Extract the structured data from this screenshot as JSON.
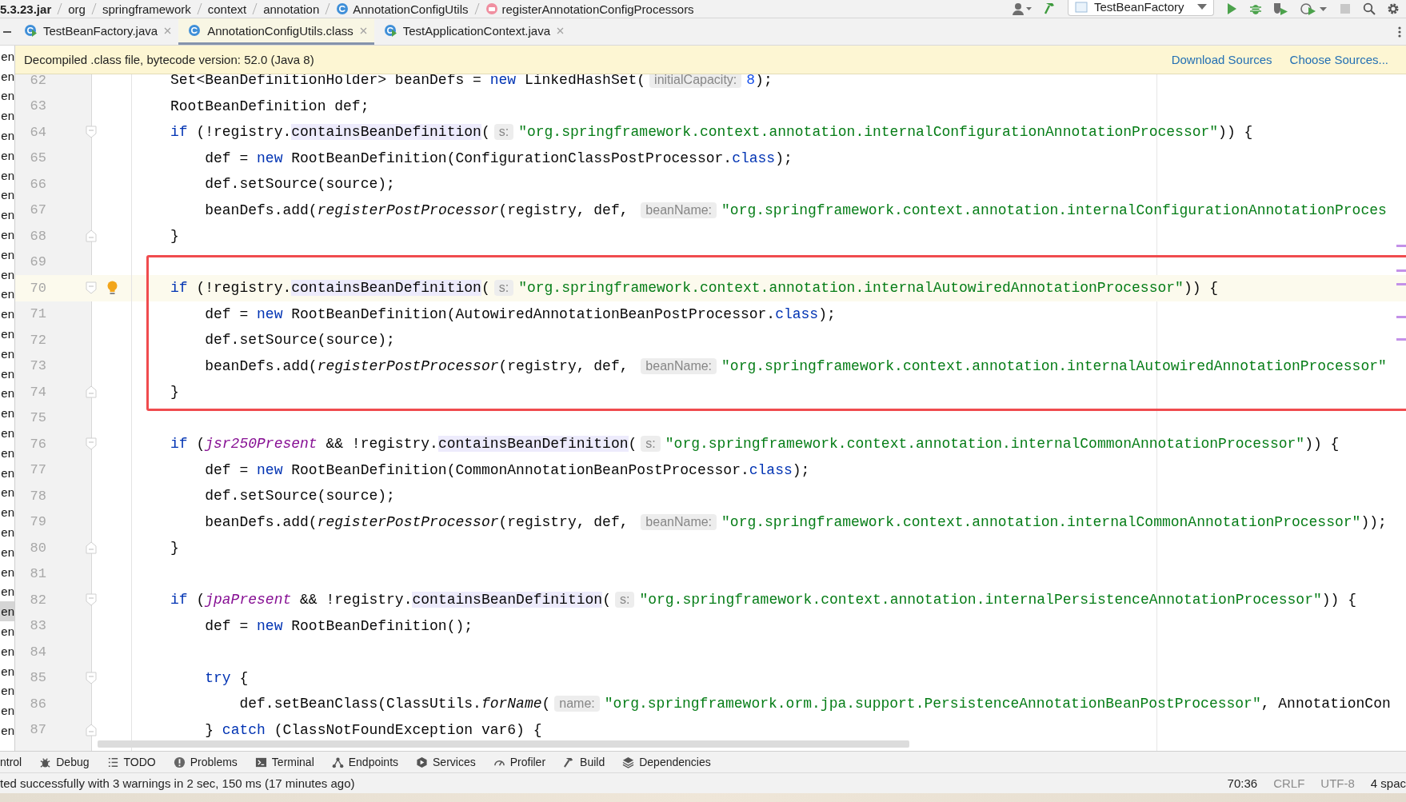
{
  "breadcrumbs": [
    {
      "label": "5.3.23.jar",
      "kind": "jar"
    },
    {
      "label": "org",
      "kind": "package"
    },
    {
      "label": "springframework",
      "kind": "package"
    },
    {
      "label": "context",
      "kind": "package"
    },
    {
      "label": "annotation",
      "kind": "package"
    },
    {
      "label": "AnnotationConfigUtils",
      "kind": "class"
    },
    {
      "label": "registerAnnotationConfigProcessors",
      "kind": "method"
    }
  ],
  "run_configuration": {
    "label": "TestBeanFactory"
  },
  "tabs": [
    {
      "label": "TestBeanFactory.java",
      "selected": false
    },
    {
      "label": "AnnotationConfigUtils.class",
      "selected": true
    },
    {
      "label": "TestApplicationContext.java",
      "selected": false
    }
  ],
  "notice": {
    "text": "Decompiled .class file, bytecode version: 52.0 (Java 8)",
    "links": [
      "Download Sources",
      "Choose Sources..."
    ]
  },
  "project_tree": {
    "items": [
      {
        "label": "en",
        "selected": false
      },
      {
        "label": "en",
        "selected": false
      },
      {
        "label": "en",
        "selected": false
      },
      {
        "label": "en",
        "selected": false
      },
      {
        "label": "en",
        "selected": false
      },
      {
        "label": "en",
        "selected": false
      },
      {
        "label": "en",
        "selected": false
      },
      {
        "label": "en",
        "selected": false
      },
      {
        "label": "en",
        "selected": false
      },
      {
        "label": "en",
        "selected": false
      },
      {
        "label": "en",
        "selected": false
      },
      {
        "label": "en",
        "selected": false
      },
      {
        "label": "en",
        "selected": false
      },
      {
        "label": "en",
        "selected": false
      },
      {
        "label": "en",
        "selected": false
      },
      {
        "label": "en",
        "selected": false
      },
      {
        "label": "en",
        "selected": false
      },
      {
        "label": "en",
        "selected": false
      },
      {
        "label": "en",
        "selected": false
      },
      {
        "label": "en",
        "selected": false
      },
      {
        "label": "en",
        "selected": false
      },
      {
        "label": "en",
        "selected": false
      },
      {
        "label": "en",
        "selected": false
      },
      {
        "label": "en",
        "selected": false
      },
      {
        "label": "en",
        "selected": false
      },
      {
        "label": "en",
        "selected": false
      },
      {
        "label": "en",
        "selected": false
      },
      {
        "label": "en",
        "selected": false
      },
      {
        "label": "en",
        "selected": true
      },
      {
        "label": "en",
        "selected": false
      },
      {
        "label": "en",
        "selected": false
      },
      {
        "label": "en",
        "selected": false
      },
      {
        "label": "en",
        "selected": false
      },
      {
        "label": "en",
        "selected": false
      },
      {
        "label": "en",
        "selected": false
      }
    ]
  },
  "code_blocks": [
    {
      "highlighted": false,
      "lines": [
        {
          "number": "62",
          "kind": "plain",
          "current": false,
          "bulb": false,
          "tokens": [
            {
              "kind": "plain",
              "text": "Set<BeanDefinitionHolder> beanDefs = "
            },
            {
              "kind": "keyword",
              "text": "new"
            },
            {
              "kind": "plain",
              "text": " LinkedHashSet("
            },
            {
              "kind": "hint",
              "text": "initialCapacity:"
            },
            {
              "kind": "number",
              "text": "8"
            },
            {
              "kind": "plain",
              "text": ");"
            }
          ]
        },
        {
          "number": "63",
          "kind": "plain",
          "current": false,
          "bulb": false,
          "tokens": [
            {
              "kind": "plain",
              "text": "RootBeanDefinition def;"
            }
          ]
        },
        {
          "number": "64",
          "kind": "fold-start",
          "current": false,
          "bulb": false,
          "tokens": [
            {
              "kind": "keyword",
              "text": "if"
            },
            {
              "kind": "plain",
              "text": " (!registry."
            },
            {
              "kind": "usage",
              "text": "containsBeanDefinition"
            },
            {
              "kind": "plain",
              "text": "("
            },
            {
              "kind": "hint",
              "text": "s:"
            },
            {
              "kind": "string",
              "text": "\"org.springframework.context.annotation.internalConfigurationAnnotationProcessor\""
            },
            {
              "kind": "plain",
              "text": ")) {"
            }
          ]
        },
        {
          "number": "65",
          "kind": "plain",
          "current": false,
          "bulb": false,
          "tokens": [
            {
              "kind": "plain",
              "text": "    def = "
            },
            {
              "kind": "keyword",
              "text": "new"
            },
            {
              "kind": "plain",
              "text": " RootBeanDefinition(ConfigurationClassPostProcessor."
            },
            {
              "kind": "keyword",
              "text": "class"
            },
            {
              "kind": "plain",
              "text": ");"
            }
          ]
        },
        {
          "number": "66",
          "kind": "plain",
          "current": false,
          "bulb": false,
          "tokens": [
            {
              "kind": "plain",
              "text": "    def.setSource(source);"
            }
          ]
        },
        {
          "number": "67",
          "kind": "plain",
          "current": false,
          "bulb": false,
          "tokens": [
            {
              "kind": "plain",
              "text": "    beanDefs.add("
            },
            {
              "kind": "call",
              "text": "registerPostProcessor"
            },
            {
              "kind": "plain",
              "text": "(registry, def, "
            },
            {
              "kind": "hint",
              "text": "beanName:"
            },
            {
              "kind": "string",
              "text": "\"org.springframework.context.annotation.internalConfigurationAnnotationProces"
            }
          ]
        },
        {
          "number": "68",
          "kind": "fold-end",
          "current": false,
          "bulb": false,
          "tokens": [
            {
              "kind": "plain",
              "text": "}"
            }
          ]
        }
      ]
    },
    {
      "highlighted": true,
      "lines": [
        {
          "number": "69",
          "kind": "plain",
          "current": false,
          "bulb": false
        },
        {
          "number": "70",
          "kind": "fold-start",
          "current": true,
          "bulb": true,
          "tokens": [
            {
              "kind": "keyword",
              "text": "if"
            },
            {
              "kind": "plain",
              "text": " (!registry."
            },
            {
              "kind": "usage",
              "text": "containsBeanDefinition"
            },
            {
              "kind": "plain",
              "text": "("
            },
            {
              "kind": "hint",
              "text": "s:"
            },
            {
              "kind": "string",
              "text": "\"org.springframework.context.annotation.internalAutowiredAnnotationProcessor\""
            },
            {
              "kind": "plain",
              "text": ")) {"
            }
          ]
        },
        {
          "number": "71",
          "kind": "plain",
          "current": false,
          "bulb": false,
          "tokens": [
            {
              "kind": "plain",
              "text": "    def = "
            },
            {
              "kind": "keyword",
              "text": "new"
            },
            {
              "kind": "plain",
              "text": " RootBeanDefinition(AutowiredAnnotationBeanPostProcessor."
            },
            {
              "kind": "keyword",
              "text": "class"
            },
            {
              "kind": "plain",
              "text": ");"
            }
          ]
        },
        {
          "number": "72",
          "kind": "plain",
          "current": false,
          "bulb": false,
          "tokens": [
            {
              "kind": "plain",
              "text": "    def.setSource(source);"
            }
          ]
        },
        {
          "number": "73",
          "kind": "plain",
          "current": false,
          "bulb": false,
          "tokens": [
            {
              "kind": "plain",
              "text": "    beanDefs.add("
            },
            {
              "kind": "call",
              "text": "registerPostProcessor"
            },
            {
              "kind": "plain",
              "text": "(registry, def, "
            },
            {
              "kind": "hint",
              "text": "beanName:"
            },
            {
              "kind": "string",
              "text": "\"org.springframework.context.annotation.internalAutowiredAnnotationProcessor\""
            }
          ]
        },
        {
          "number": "74",
          "kind": "fold-end",
          "current": false,
          "bulb": false,
          "tokens": [
            {
              "kind": "plain",
              "text": "}"
            }
          ]
        }
      ]
    },
    {
      "highlighted": false,
      "lines": [
        {
          "number": "75",
          "kind": "plain",
          "current": false,
          "bulb": false
        },
        {
          "number": "76",
          "kind": "fold-start",
          "current": false,
          "bulb": false,
          "tokens": [
            {
              "kind": "keyword",
              "text": "if"
            },
            {
              "kind": "plain",
              "text": " ("
            },
            {
              "kind": "static",
              "text": "jsr250Present"
            },
            {
              "kind": "plain",
              "text": " && !registry."
            },
            {
              "kind": "usage",
              "text": "containsBeanDefinition"
            },
            {
              "kind": "plain",
              "text": "("
            },
            {
              "kind": "hint",
              "text": "s:"
            },
            {
              "kind": "string",
              "text": "\"org.springframework.context.annotation.internalCommonAnnotationProcessor\""
            },
            {
              "kind": "plain",
              "text": ")) {"
            }
          ]
        },
        {
          "number": "77",
          "kind": "plain",
          "current": false,
          "bulb": false,
          "tokens": [
            {
              "kind": "plain",
              "text": "    def = "
            },
            {
              "kind": "keyword",
              "text": "new"
            },
            {
              "kind": "plain",
              "text": " RootBeanDefinition(CommonAnnotationBeanPostProcessor."
            },
            {
              "kind": "keyword",
              "text": "class"
            },
            {
              "kind": "plain",
              "text": ");"
            }
          ]
        },
        {
          "number": "78",
          "kind": "plain",
          "current": false,
          "bulb": false,
          "tokens": [
            {
              "kind": "plain",
              "text": "    def.setSource(source);"
            }
          ]
        },
        {
          "number": "79",
          "kind": "plain",
          "current": false,
          "bulb": false,
          "tokens": [
            {
              "kind": "plain",
              "text": "    beanDefs.add("
            },
            {
              "kind": "call",
              "text": "registerPostProcessor"
            },
            {
              "kind": "plain",
              "text": "(registry, def, "
            },
            {
              "kind": "hint",
              "text": "beanName:"
            },
            {
              "kind": "string",
              "text": "\"org.springframework.context.annotation.internalCommonAnnotationProcessor\""
            },
            {
              "kind": "plain",
              "text": "));"
            }
          ]
        },
        {
          "number": "80",
          "kind": "fold-end",
          "current": false,
          "bulb": false,
          "tokens": [
            {
              "kind": "plain",
              "text": "}"
            }
          ]
        },
        {
          "number": "81",
          "kind": "plain",
          "current": false,
          "bulb": false
        },
        {
          "number": "82",
          "kind": "fold-start",
          "current": false,
          "bulb": false,
          "tokens": [
            {
              "kind": "keyword",
              "text": "if"
            },
            {
              "kind": "plain",
              "text": " ("
            },
            {
              "kind": "static",
              "text": "jpaPresent"
            },
            {
              "kind": "plain",
              "text": " && !registry."
            },
            {
              "kind": "usage",
              "text": "containsBeanDefinition"
            },
            {
              "kind": "plain",
              "text": "("
            },
            {
              "kind": "hint",
              "text": "s:"
            },
            {
              "kind": "string",
              "text": "\"org.springframework.context.annotation.internalPersistenceAnnotationProcessor\""
            },
            {
              "kind": "plain",
              "text": ")) {"
            }
          ]
        },
        {
          "number": "83",
          "kind": "plain",
          "current": false,
          "bulb": false,
          "tokens": [
            {
              "kind": "plain",
              "text": "    def = "
            },
            {
              "kind": "keyword",
              "text": "new"
            },
            {
              "kind": "plain",
              "text": " RootBeanDefinition();"
            }
          ]
        },
        {
          "number": "84",
          "kind": "plain",
          "current": false,
          "bulb": false
        },
        {
          "number": "85",
          "kind": "fold-start",
          "current": false,
          "bulb": false,
          "tokens": [
            {
              "kind": "keyword",
              "text": "    try"
            },
            {
              "kind": "plain",
              "text": " {"
            }
          ]
        },
        {
          "number": "86",
          "kind": "plain",
          "current": false,
          "bulb": false,
          "tokens": [
            {
              "kind": "plain",
              "text": "        def.setBeanClass(ClassUtils."
            },
            {
              "kind": "call",
              "text": "forName"
            },
            {
              "kind": "plain",
              "text": "("
            },
            {
              "kind": "hint",
              "text": "name:"
            },
            {
              "kind": "string",
              "text": "\"org.springframework.orm.jpa.support.PersistenceAnnotationBeanPostProcessor\""
            },
            {
              "kind": "plain",
              "text": ", AnnotationCon"
            }
          ]
        },
        {
          "number": "87",
          "kind": "fold-end",
          "current": false,
          "bulb": false,
          "tokens": [
            {
              "kind": "plain",
              "text": "    } "
            },
            {
              "kind": "keyword",
              "text": "catch"
            },
            {
              "kind": "plain",
              "text": " (ClassNotFoundException var6) {"
            }
          ]
        }
      ]
    }
  ],
  "tool_windows": [
    {
      "label": "ntrol"
    },
    {
      "label": "Debug"
    },
    {
      "label": "TODO"
    },
    {
      "label": "Problems"
    },
    {
      "label": "Terminal"
    },
    {
      "label": "Endpoints"
    },
    {
      "label": "Services"
    },
    {
      "label": "Profiler"
    },
    {
      "label": "Build"
    },
    {
      "label": "Dependencies"
    }
  ],
  "status_bar": {
    "message": "ted successfully with 3 warnings in 2 sec, 150 ms (17 minutes ago)",
    "position": "70:36",
    "line_separator": "CRLF",
    "encoding": "UTF-8",
    "indent": "4 spac"
  }
}
